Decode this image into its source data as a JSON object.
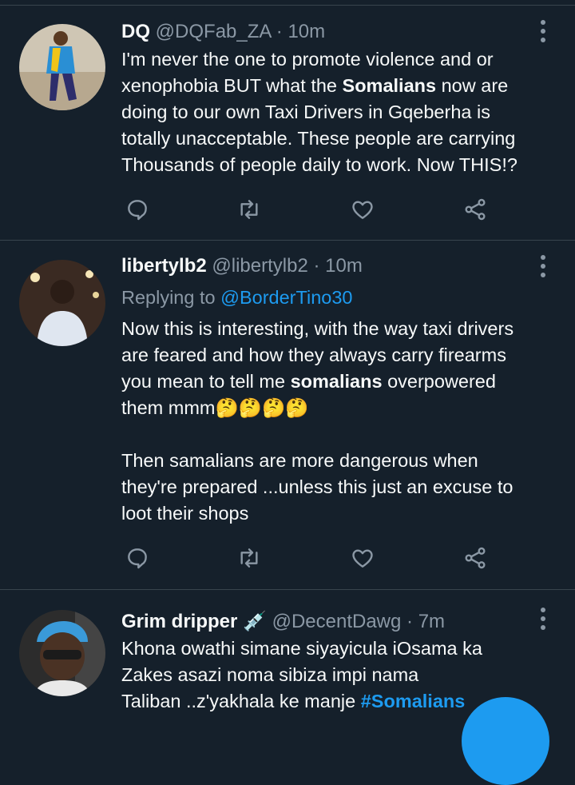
{
  "tweets": [
    {
      "name": "DQ",
      "handle": "@DQFab_ZA",
      "separator": "·",
      "time": "10m",
      "body": {
        "line1": "I'm never the one to promote violence and or",
        "line2_pre": "xenophobia BUT what the ",
        "line2_bold": "Somalians",
        "line2_post": " now are",
        "line3": "doing to our own Taxi Drivers in Gqeberha is",
        "line4": "totally unacceptable. These people are carrying",
        "line5": "Thousands of people daily to work. Now THIS!?"
      }
    },
    {
      "name": "libertylb2",
      "handle": "@libertylb2",
      "separator": "·",
      "time": "10m",
      "replying_label": "Replying to",
      "replying_handle": "@BorderTino30",
      "body": {
        "line1": "Now this is interesting, with the way taxi drivers",
        "line2": "are feared and how they always carry firearms",
        "line3_pre": "you mean to tell me ",
        "line3_bold": "somalians",
        "line3_post": " overpowered",
        "line4": "them mmm🤔🤔🤔🤔",
        "line5": "Then samalians are more dangerous  when",
        "line6": "they're prepared ...unless this just an excuse to",
        "line7": "loot their shops"
      }
    },
    {
      "name": "Grim dripper",
      "name_emoji": "💉",
      "handle": "@DecentDawg",
      "separator": "·",
      "time": "7m",
      "body": {
        "line1": "Khona owathi simane siyayicula iOsama ka",
        "line2": "Zakes asazi noma sibiza impi nama",
        "line3_pre": "Taliban ..z'yakhala ke manje ",
        "line3_link": "#Somalians"
      }
    }
  ],
  "icons": {
    "reply": "reply-icon",
    "retweet": "retweet-icon",
    "like": "like-icon",
    "share": "share-icon",
    "more": "more-options-icon",
    "compose": "compose-fab"
  },
  "colors": {
    "background": "#15202b",
    "text": "#f7f9f9",
    "secondary": "#8b98a5",
    "accent": "#1d9bf0",
    "divider": "#38444d"
  }
}
